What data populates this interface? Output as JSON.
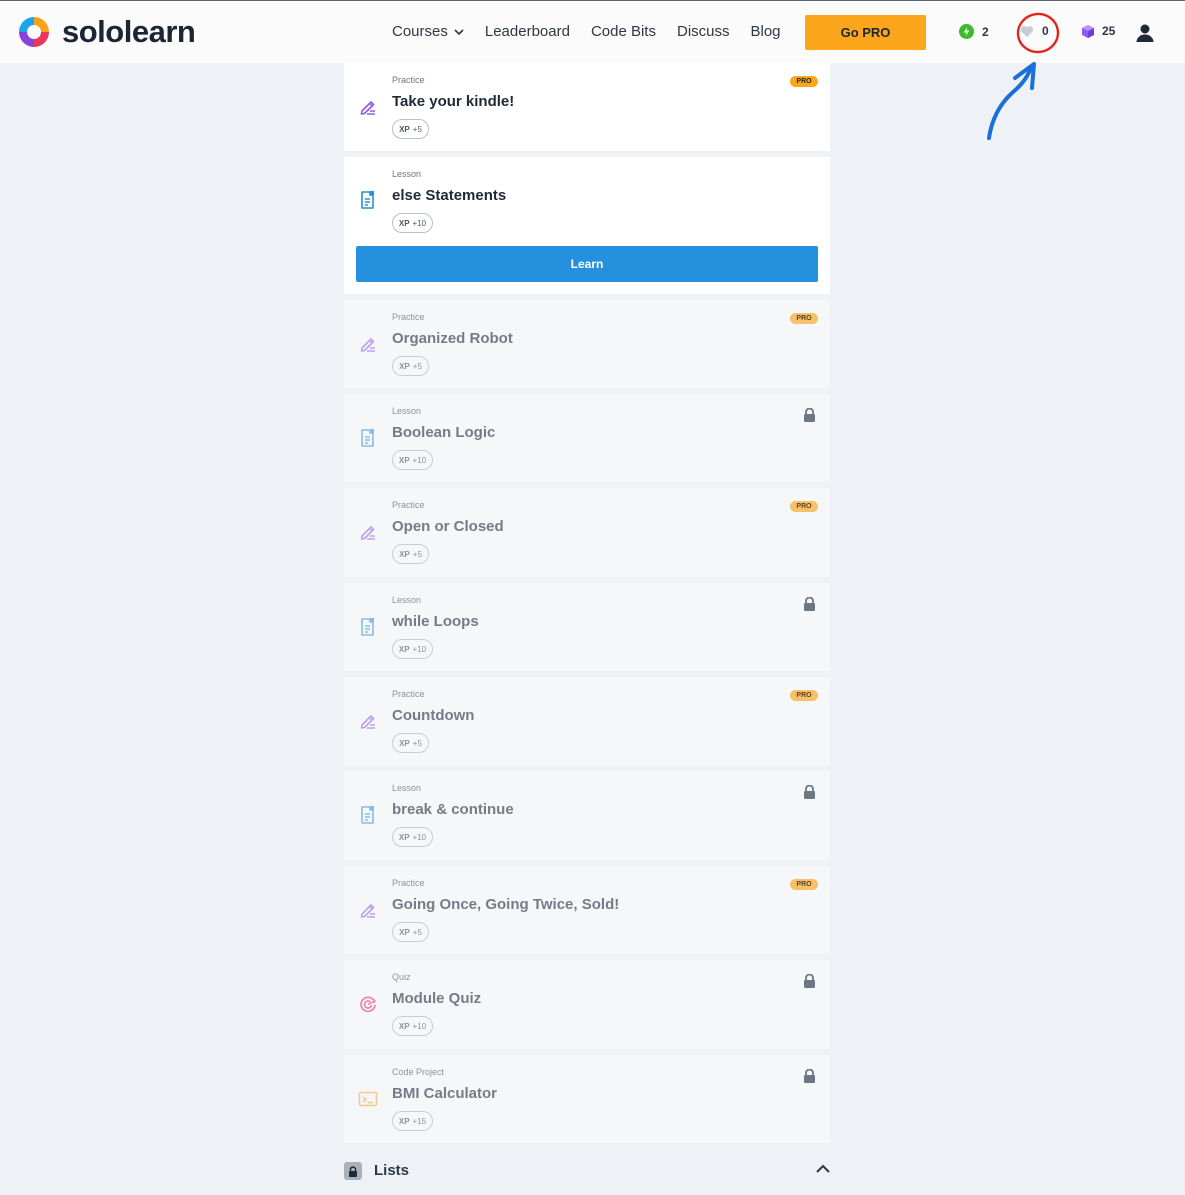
{
  "header": {
    "logo_text": "sololearn",
    "nav": [
      {
        "label": "Courses"
      },
      {
        "label": "Leaderboard"
      },
      {
        "label": "Code Bits"
      },
      {
        "label": "Discuss"
      },
      {
        "label": "Blog"
      }
    ],
    "go_pro_label": "Go PRO",
    "streak_count": "2",
    "hearts_count": "0",
    "bits_count": "25",
    "colors": {
      "go_pro": "#fda51b",
      "streak": "#3cba2b",
      "bits": "#8a5cf5"
    }
  },
  "items": [
    {
      "kind": "Practice",
      "title": "Take your kindle!",
      "xp_label": "XP",
      "xp": "+5",
      "badge": "PRO",
      "icon": "pencil-icon"
    },
    {
      "kind": "Lesson",
      "title": "else Statements",
      "xp_label": "XP",
      "xp": "+10",
      "action": "Learn",
      "icon": "document-icon"
    },
    {
      "kind": "Practice",
      "title": "Organized Robot",
      "xp_label": "XP",
      "xp": "+5",
      "badge": "PRO",
      "icon": "pencil-icon"
    },
    {
      "kind": "Lesson",
      "title": "Boolean Logic",
      "xp_label": "XP",
      "xp": "+10",
      "locked": true,
      "icon": "document-icon"
    },
    {
      "kind": "Practice",
      "title": "Open or Closed",
      "xp_label": "XP",
      "xp": "+5",
      "badge": "PRO",
      "icon": "pencil-icon"
    },
    {
      "kind": "Lesson",
      "title": "while Loops",
      "xp_label": "XP",
      "xp": "+10",
      "locked": true,
      "icon": "document-icon"
    },
    {
      "kind": "Practice",
      "title": "Countdown",
      "xp_label": "XP",
      "xp": "+5",
      "badge": "PRO",
      "icon": "pencil-icon"
    },
    {
      "kind": "Lesson",
      "title": "break & continue",
      "xp_label": "XP",
      "xp": "+10",
      "locked": true,
      "icon": "document-icon"
    },
    {
      "kind": "Practice",
      "title": "Going Once, Going Twice, Sold!",
      "xp_label": "XP",
      "xp": "+5",
      "badge": "PRO",
      "icon": "pencil-icon"
    },
    {
      "kind": "Quiz",
      "title": "Module Quiz",
      "xp_label": "XP",
      "xp": "+10",
      "locked": true,
      "icon": "target-icon"
    },
    {
      "kind": "Code Project",
      "title": "BMI Calculator",
      "xp_label": "XP",
      "xp": "+15",
      "locked": true,
      "icon": "terminal-icon"
    }
  ],
  "lists_section": {
    "title": "Lists"
  }
}
